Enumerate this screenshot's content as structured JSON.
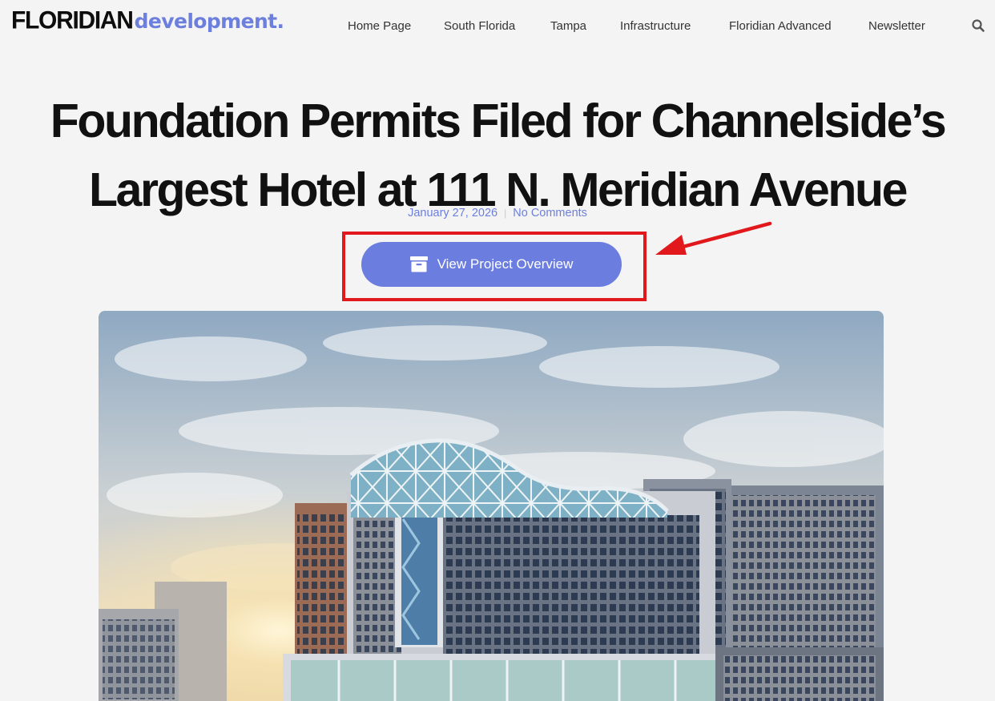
{
  "logo": {
    "main": "FLORIDIAN",
    "sub": "development."
  },
  "nav": [
    {
      "label": "Home Page"
    },
    {
      "label": "South Florida"
    },
    {
      "label": "Tampa"
    },
    {
      "label": "Infrastructure"
    },
    {
      "label": "Floridian Advanced"
    },
    {
      "label": "Newsletter"
    }
  ],
  "article": {
    "title_line1": "Foundation Permits Filed for Channelside’s",
    "title_line2": "Largest Hotel at 111 N. Meridian Avenue",
    "date": "January 27, 2026",
    "comments": "No Comments",
    "cta_label": "View Project Overview"
  },
  "icons": {
    "search": "search-icon",
    "cta": "archive-box-icon",
    "annotation": "red-arrow-icon"
  },
  "colors": {
    "accent": "#6c7de0",
    "logo_accent": "#6d7fdc",
    "highlight": "#e2191c",
    "background": "#f4f4f4"
  }
}
